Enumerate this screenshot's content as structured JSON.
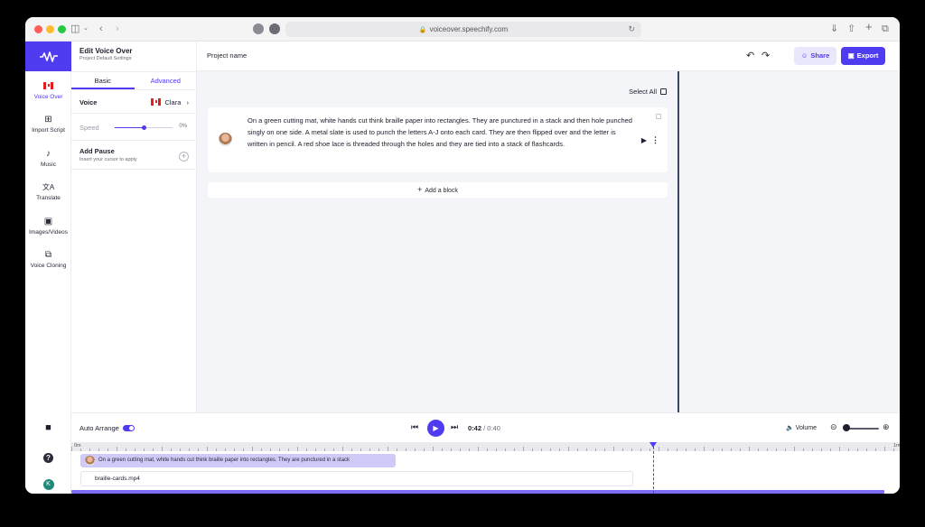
{
  "browser": {
    "url": "voiceover.speechify.com"
  },
  "rail": {
    "items": [
      {
        "label": "Voice Over",
        "icon": "canada-flag-icon"
      },
      {
        "label": "Import Script",
        "icon": "plus-square-icon"
      },
      {
        "label": "Music",
        "icon": "music-note-icon"
      },
      {
        "label": "Translate",
        "icon": "translate-icon"
      },
      {
        "label": "Images/Videos",
        "icon": "images-icon"
      },
      {
        "label": "Voice Cloning",
        "icon": "clone-icon"
      }
    ],
    "avatar_letter": "K"
  },
  "panel": {
    "title": "Edit Voice Over",
    "subtitle": "Project Default Settings",
    "tabs": [
      "Basic",
      "Advanced"
    ],
    "voice_label": "Voice",
    "voice_value": "Clara",
    "speed_label": "Speed",
    "speed_value": "0%",
    "speed_level": 0.5,
    "pause_label": "Add Pause",
    "pause_hint": "Insert your cursor to apply"
  },
  "toolbar": {
    "project_name": "Project name",
    "share_label": "Share",
    "export_label": "Export"
  },
  "script": {
    "select_all": "Select All",
    "block_text": "On a green cutting mat, white hands cut think braille paper into rectangles. They are punctured in a stack and then hole punched singly on one side. A metal slate is used to punch the letters A-J  onto each card. They are then flipped over and the letter is written in pencil. A red shoe lace is threaded through the holes and they are tied into a stack of flashcards.",
    "add_block": "Add a block"
  },
  "playback": {
    "auto_arrange": "Auto Arrange",
    "current_time": "0:42",
    "total_time": "0:40",
    "volume_label": "Volume"
  },
  "timeline": {
    "start_label": "0m",
    "end_label": "1m",
    "audio_clip": "On a green cutting mat, white hands cut think braille paper into rectangles. They are punctured in a stack",
    "video_clip": "braille-cards.mp4"
  },
  "colors": {
    "accent": "#4f3bf0",
    "share_bg": "#e8e7fb"
  }
}
